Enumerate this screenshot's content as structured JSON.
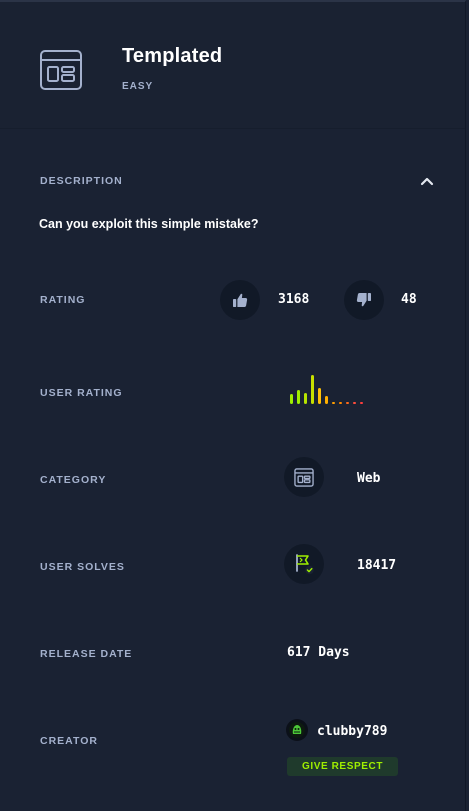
{
  "challenge": {
    "title": "Templated",
    "difficulty": "EASY",
    "icon": "web-template-icon"
  },
  "description": {
    "label": "DESCRIPTION",
    "text": "Can you exploit this simple mistake?",
    "toggle_icon": "chevron-up-icon"
  },
  "rating": {
    "label": "RATING",
    "likes": "3168",
    "dislikes": "48"
  },
  "user_rating": {
    "label": "USER RATING",
    "distribution": [
      {
        "level": 0.3,
        "color": "#9fef00"
      },
      {
        "level": 0.45,
        "color": "#9fef00"
      },
      {
        "level": 0.35,
        "color": "#b6e300"
      },
      {
        "level": 0.9,
        "color": "#c8e000"
      },
      {
        "level": 0.5,
        "color": "#ffc107"
      },
      {
        "level": 0.25,
        "color": "#ffaf00"
      },
      {
        "level": 0.07,
        "color": "#ff9f00"
      },
      {
        "level": 0.05,
        "color": "#ff8a00"
      },
      {
        "level": 0.04,
        "color": "#ff6a1a"
      },
      {
        "level": 0.04,
        "color": "#ff4d3c"
      },
      {
        "level": 0.04,
        "color": "#ff3e3e"
      }
    ]
  },
  "category": {
    "label": "CATEGORY",
    "value": "Web",
    "icon": "web-template-icon"
  },
  "user_solves": {
    "label": "USER SOLVES",
    "value": "18417",
    "icon": "flag-solved-icon"
  },
  "release_date": {
    "label": "RELEASE DATE",
    "value": "617 Days"
  },
  "creator": {
    "label": "CREATOR",
    "name": "clubby789",
    "button": "GIVE RESPECT"
  },
  "colors": {
    "background": "#1a2233",
    "accent": "#9fef00",
    "text_muted": "#a4b1cd"
  }
}
